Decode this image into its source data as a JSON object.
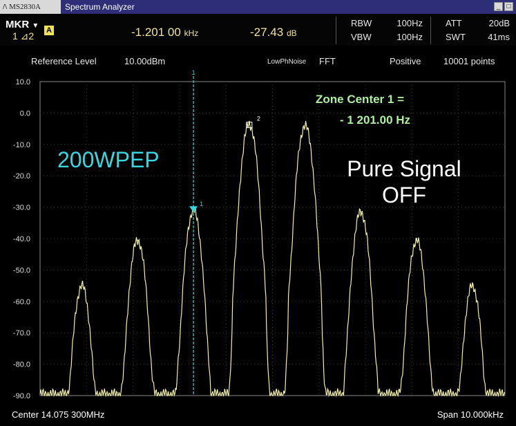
{
  "window": {
    "logo_mark": "/\\",
    "model": "MS2830A",
    "title": "Spectrum Analyzer",
    "btn_min": "_",
    "btn_max": "□"
  },
  "marker": {
    "label": "MKR",
    "dropdown_glyph": "▼",
    "sub": "1 ⊿2",
    "trace_badge": "A",
    "freq_value": "-1.201 00",
    "freq_unit": "kHz",
    "level_value": "-27.43",
    "level_unit": "dB"
  },
  "params": {
    "rbw_label": "RBW",
    "rbw": "100Hz",
    "vbw_label": "VBW",
    "vbw": "100Hz",
    "att_label": "ATT",
    "att": "20dB",
    "swt_label": "SWT",
    "swt": "41ms"
  },
  "info": {
    "ref_label": "Reference Level",
    "ref_value": "10.00dBm",
    "noise_mode": "LowPhNoise",
    "mode": "FFT",
    "detector": "Positive",
    "points": "10001 points"
  },
  "footer": {
    "center": "Center 14.075 300MHz",
    "span": "Span 10.000kHz"
  },
  "colors": {
    "trace": "#f3f0a8",
    "marker": "#39d6e0",
    "accent": "#f1e39a",
    "zone": "#aef0a0"
  },
  "chart_data": {
    "type": "line",
    "ylim": [
      -90,
      10
    ],
    "yticks": [
      "10.0",
      "0.0",
      "-10.0",
      "-20.0",
      "-30.0",
      "-40.0",
      "-50.0",
      "-60.0",
      "-70.0",
      "-80.0",
      "-90.0"
    ],
    "xlim": [
      -5000,
      5000
    ],
    "xunit": "Hz offset from center",
    "series": [
      {
        "peaks": [
          {
            "x": -4100,
            "y": -55.0
          },
          {
            "x": -2900,
            "y": -40.5
          },
          {
            "x": -1700,
            "y": -31.0
          },
          {
            "x": -500,
            "y": -3.5
          },
          {
            "x": 700,
            "y": -4.0
          },
          {
            "x": 1900,
            "y": -31.5
          },
          {
            "x": 3100,
            "y": -40.5
          },
          {
            "x": 4300,
            "y": -55.0
          }
        ],
        "noise_floor": -89.5
      }
    ],
    "markers": [
      {
        "id": "1",
        "x": -1700,
        "y": -30.8,
        "label": "1",
        "style": "triangle"
      },
      {
        "id": "2",
        "x": -500,
        "y": -3.8,
        "label": "2",
        "style": "square"
      }
    ],
    "annotations": {
      "zone_line1": "Zone Center 1 =",
      "zone_line2": "- 1 201.00 Hz",
      "power": "200WPEP",
      "pure_line1": "Pure Signal",
      "pure_line2": "OFF"
    }
  }
}
